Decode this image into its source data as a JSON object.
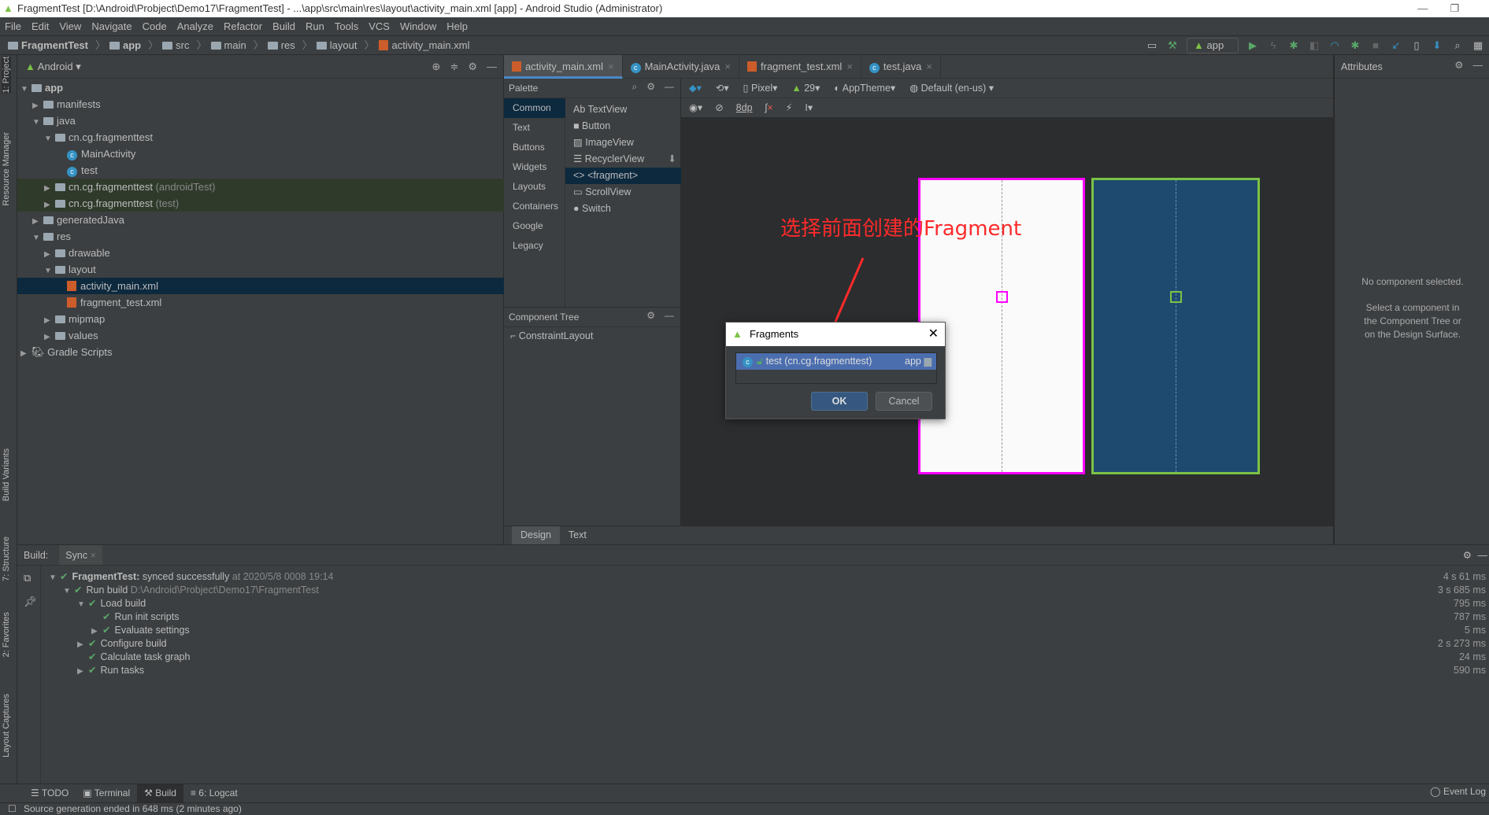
{
  "title": "FragmentTest [D:\\Android\\Probject\\Demo17\\FragmentTest] - ...\\app\\src\\main\\res\\layout\\activity_main.xml [app] - Android Studio (Administrator)",
  "menu": [
    "File",
    "Edit",
    "View",
    "Navigate",
    "Code",
    "Analyze",
    "Refactor",
    "Build",
    "Run",
    "Tools",
    "VCS",
    "Window",
    "Help"
  ],
  "breadcrumb": [
    "FragmentTest",
    "app",
    "src",
    "main",
    "res",
    "layout",
    "activity_main.xml"
  ],
  "run_config": "app",
  "left_strip": [
    "1: Project",
    "Resource Manager",
    "Build Variants",
    "7: Structure",
    "2: Favorites",
    "Layout Captures"
  ],
  "project": {
    "view": "Android",
    "tree": [
      {
        "label": "app",
        "level": 0,
        "arrow": "down",
        "icon": "folder",
        "bold": true
      },
      {
        "label": "manifests",
        "level": 1,
        "arrow": "right",
        "icon": "folder"
      },
      {
        "label": "java",
        "level": 1,
        "arrow": "down",
        "icon": "folder"
      },
      {
        "label": "cn.cg.fragmenttest",
        "level": 2,
        "arrow": "down",
        "icon": "package"
      },
      {
        "label": "MainActivity",
        "level": 3,
        "icon": "class"
      },
      {
        "label": "test",
        "level": 3,
        "icon": "class"
      },
      {
        "label": "cn.cg.fragmenttest",
        "suffix": "(androidTest)",
        "level": 2,
        "arrow": "right",
        "icon": "package",
        "style": "test"
      },
      {
        "label": "cn.cg.fragmenttest",
        "suffix": "(test)",
        "level": 2,
        "arrow": "right",
        "icon": "package",
        "style": "test"
      },
      {
        "label": "generatedJava",
        "level": 1,
        "arrow": "right",
        "icon": "folder"
      },
      {
        "label": "res",
        "level": 1,
        "arrow": "down",
        "icon": "folder"
      },
      {
        "label": "drawable",
        "level": 2,
        "arrow": "right",
        "icon": "folder"
      },
      {
        "label": "layout",
        "level": 2,
        "arrow": "down",
        "icon": "folder"
      },
      {
        "label": "activity_main.xml",
        "level": 3,
        "icon": "xml",
        "style": "sel"
      },
      {
        "label": "fragment_test.xml",
        "level": 3,
        "icon": "xml"
      },
      {
        "label": "mipmap",
        "level": 2,
        "arrow": "right",
        "icon": "folder"
      },
      {
        "label": "values",
        "level": 2,
        "arrow": "right",
        "icon": "folder"
      },
      {
        "label": "Gradle Scripts",
        "level": 0,
        "arrow": "right",
        "icon": "gradle"
      }
    ]
  },
  "editor_tabs": [
    {
      "label": "activity_main.xml",
      "icon": "xml",
      "active": true
    },
    {
      "label": "MainActivity.java",
      "icon": "class"
    },
    {
      "label": "fragment_test.xml",
      "icon": "xml"
    },
    {
      "label": "test.java",
      "icon": "class"
    }
  ],
  "palette": {
    "title": "Palette",
    "categories": [
      "Common",
      "Text",
      "Buttons",
      "Widgets",
      "Layouts",
      "Containers",
      "Google",
      "Legacy"
    ],
    "selected_category": "Common",
    "items": [
      {
        "icon": "Ab",
        "label": "TextView"
      },
      {
        "icon": "■",
        "label": "Button"
      },
      {
        "icon": "▨",
        "label": "ImageView"
      },
      {
        "icon": "☰",
        "label": "RecyclerView",
        "download": true
      },
      {
        "icon": "<>",
        "label": "<fragment>",
        "selected": true
      },
      {
        "icon": "▭",
        "label": "ScrollView"
      },
      {
        "icon": "●",
        "label": "Switch"
      }
    ]
  },
  "component_tree": {
    "title": "Component Tree",
    "root": "ConstraintLayout"
  },
  "design_toolbar": {
    "device": "Pixel",
    "api": "29",
    "theme": "AppTheme",
    "locale": "Default (en-us)",
    "margin": "8dp"
  },
  "design_tabs": [
    "Design",
    "Text"
  ],
  "attributes": {
    "title": "Attributes",
    "empty_line1": "No component selected.",
    "empty_line2": "Select a component in the Component Tree or on the Design Surface."
  },
  "annotation": "选择前面创建的Fragment",
  "dialog": {
    "title": "Fragments",
    "item": "test (cn.cg.fragmenttest)",
    "item_module": "app",
    "ok": "OK",
    "cancel": "Cancel"
  },
  "build": {
    "label": "Build:",
    "tab": "Sync",
    "rows": [
      {
        "level": 0,
        "arrow": "down",
        "bold": "FragmentTest:",
        "text": "synced successfully",
        "meta": "at 2020/5/8 0008 19:14",
        "duration": "4 s 61 ms"
      },
      {
        "level": 1,
        "arrow": "down",
        "text": "Run build",
        "meta": "D:\\Android\\Probject\\Demo17\\FragmentTest",
        "duration": "3 s 685 ms"
      },
      {
        "level": 2,
        "arrow": "down",
        "text": "Load build",
        "duration": "795 ms"
      },
      {
        "level": 3,
        "text": "Run init scripts",
        "duration": "787 ms"
      },
      {
        "level": 3,
        "arrow": "right",
        "text": "Evaluate settings",
        "duration": "5 ms"
      },
      {
        "level": 2,
        "arrow": "right",
        "text": "Configure build",
        "duration": "2 s 273 ms"
      },
      {
        "level": 2,
        "text": "Calculate task graph",
        "duration": "24 ms"
      },
      {
        "level": 2,
        "arrow": "right",
        "text": "Run tasks",
        "duration": "590 ms"
      }
    ]
  },
  "bottom_tabs": [
    {
      "label": "TODO",
      "icon": "☰"
    },
    {
      "label": "Terminal",
      "icon": "▣"
    },
    {
      "label": "Build",
      "icon": "⚒",
      "active": true
    },
    {
      "label": "6: Logcat",
      "icon": "≡"
    }
  ],
  "event_log": "Event Log",
  "status": "Source generation ended in 648 ms (2 minutes ago)",
  "colors": {
    "accent": "#4a88c7",
    "selection": "#0d293e",
    "check": "#59a869",
    "annotation": "#ff2a2a",
    "blueprint_white_border": "#ff00ff",
    "blueprint_blue_border": "#7cc246"
  }
}
